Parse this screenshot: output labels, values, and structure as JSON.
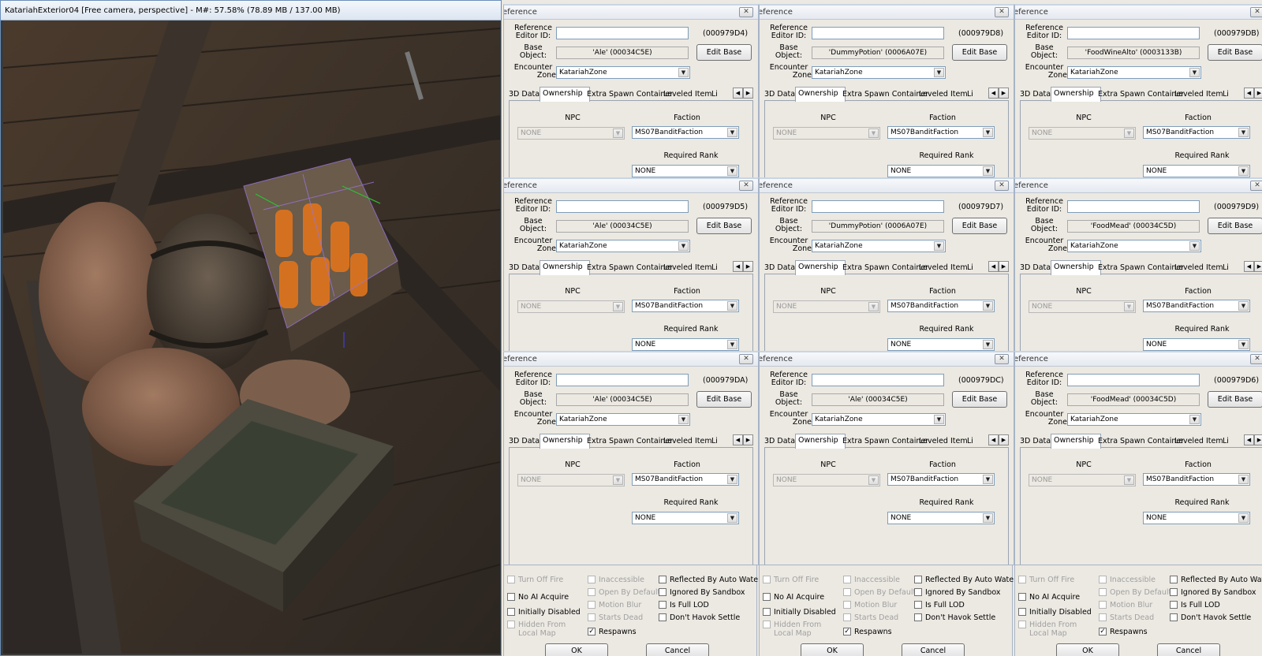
{
  "viewport": {
    "title": "KatariahExterior04 [Free camera, perspective] - M#: 57.58% (78.89 MB / 137.00 MB)"
  },
  "common": {
    "window_title": "eference",
    "close_glyph": "✕",
    "ref_label_1": "Reference",
    "ref_label_2": "Editor ID:",
    "base_label_1": "Base",
    "base_label_2": "Object:",
    "enc_label_1": "Encounter",
    "enc_label_2": "Zone",
    "edit_base": "Edit Base",
    "encounter_zone": "KatariahZone",
    "tabs": [
      "3D Data",
      "Ownership",
      "Extra",
      "Spawn Container",
      "Leveled Item",
      "Li"
    ],
    "npc_label": "NPC",
    "faction_label": "Faction",
    "required_rank_label": "Required Rank",
    "npc_value": "NONE",
    "faction_value": "MS07BanditFaction",
    "rank_value": "NONE",
    "arrow_left": "◀",
    "arrow_right": "▶",
    "dropdown_glyph": "▼",
    "ok": "OK",
    "cancel": "Cancel",
    "check_glyph": "✓"
  },
  "panels": [
    {
      "id": "(000979D4)",
      "base": "'Ale' (00034C5E)"
    },
    {
      "id": "(000979D8)",
      "base": "'DummyPotion' (0006A07E)"
    },
    {
      "id": "(000979DB)",
      "base": "'FoodWineAlto' (0003133B)"
    },
    {
      "id": "(000979D5)",
      "base": "'Ale' (00034C5E)"
    },
    {
      "id": "(000979D7)",
      "base": "'DummyPotion' (0006A07E)"
    },
    {
      "id": "(000979D9)",
      "base": "'FoodMead' (00034C5D)"
    },
    {
      "id": "(000979DA)",
      "base": "'Ale' (00034C5E)"
    },
    {
      "id": "(000979DC)",
      "base": "'Ale' (00034C5E)"
    },
    {
      "id": "(000979D6)",
      "base": "'FoodMead' (00034C5D)"
    }
  ],
  "flags": {
    "turn_off_fire": "Turn Off Fire",
    "no_ai_acquire": "No AI Acquire",
    "initially_disabled": "Initially Disabled",
    "hidden_from_1": "Hidden From",
    "hidden_from_2": "Local Map",
    "inaccessible": "Inaccessible",
    "open_by_default": "Open By Default",
    "motion_blur": "Motion Blur",
    "starts_dead": "Starts Dead",
    "respawns": "Respawns",
    "reflected_by_auto_water": "Reflected By Auto Water",
    "ignored_by_sandbox": "Ignored By Sandbox",
    "is_full_lod": "Is Full LOD",
    "dont_havok_settle": "Don't Havok Settle"
  }
}
